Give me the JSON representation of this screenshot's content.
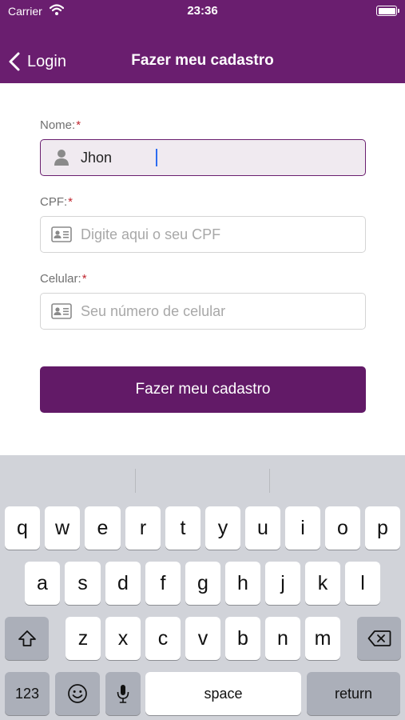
{
  "status_bar": {
    "carrier": "Carrier",
    "time": "23:36"
  },
  "nav": {
    "back_label": "Login",
    "title": "Fazer meu cadastro"
  },
  "form": {
    "nome": {
      "label": "Nome:",
      "required": "*",
      "value": "Jhon",
      "placeholder": ""
    },
    "cpf": {
      "label": "CPF:",
      "required": "*",
      "value": "",
      "placeholder": "Digite aqui o seu CPF"
    },
    "celular": {
      "label": "Celular:",
      "required": "*",
      "value": "",
      "placeholder": "Seu número de celular"
    },
    "submit_label": "Fazer meu cadastro"
  },
  "keyboard": {
    "row1": [
      "q",
      "w",
      "e",
      "r",
      "t",
      "y",
      "u",
      "i",
      "o",
      "p"
    ],
    "row2": [
      "a",
      "s",
      "d",
      "f",
      "g",
      "h",
      "j",
      "k",
      "l"
    ],
    "row3": [
      "z",
      "x",
      "c",
      "v",
      "b",
      "n",
      "m"
    ],
    "numbers_label": "123",
    "space_label": "space",
    "return_label": "return"
  },
  "colors": {
    "brand": "#6a1e6f",
    "button": "#621a67",
    "required": "#c0262f"
  }
}
